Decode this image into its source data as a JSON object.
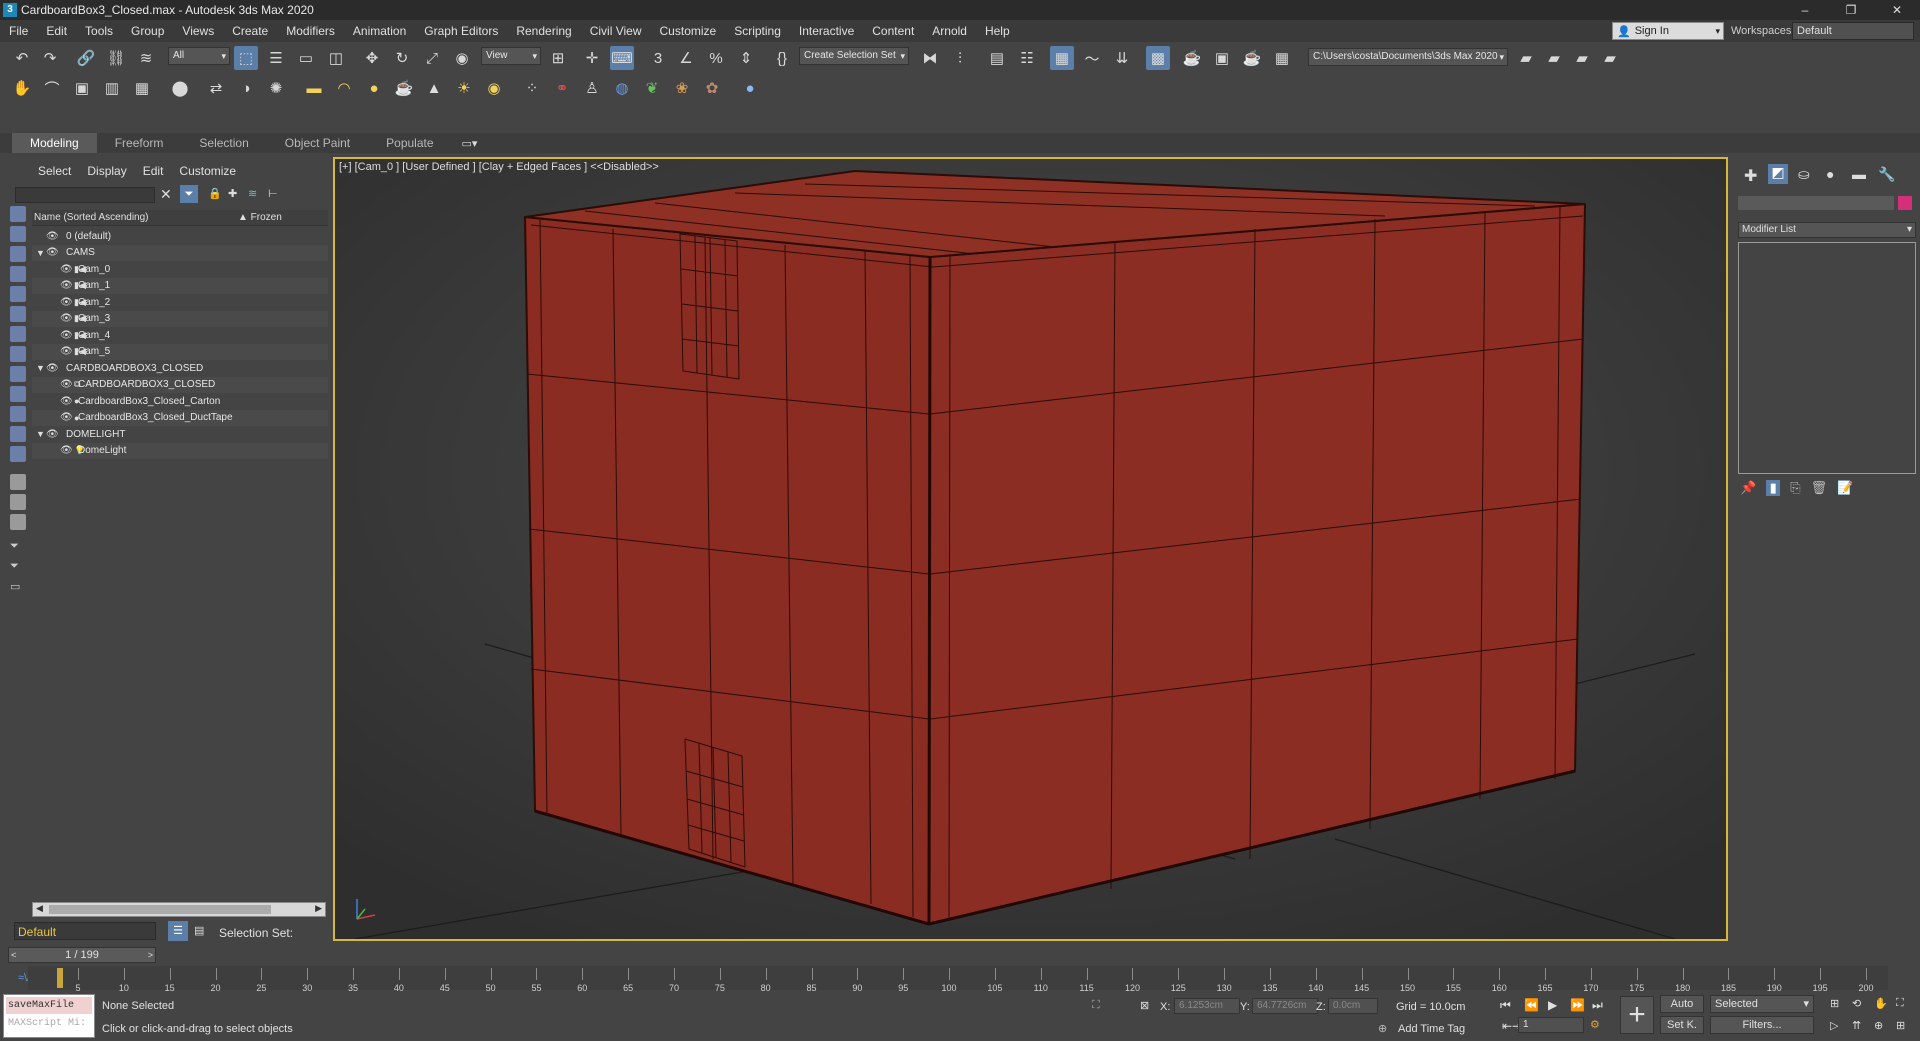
{
  "window": {
    "title": "CardboardBox3_Closed.max - Autodesk 3ds Max 2020",
    "minimize": "–",
    "restore": "❐",
    "close": "✕"
  },
  "menu": [
    "File",
    "Edit",
    "Tools",
    "Group",
    "Views",
    "Create",
    "Modifiers",
    "Animation",
    "Graph Editors",
    "Rendering",
    "Civil View",
    "Customize",
    "Scripting",
    "Interactive",
    "Content",
    "Arnold",
    "Help"
  ],
  "account": {
    "sign_in": "Sign In",
    "workspaces_label": "Workspaces:",
    "workspace": "Default"
  },
  "toolbar": {
    "selection_filter": "All",
    "ref_coord": "View",
    "named_selection": "Create Selection Set",
    "project_path": "C:\\Users\\costa\\Documents\\3ds Max 2020"
  },
  "ribbon": {
    "tabs": [
      "Modeling",
      "Freeform",
      "Selection",
      "Object Paint",
      "Populate"
    ]
  },
  "scene_explorer": {
    "tabs": [
      "Select",
      "Display",
      "Edit",
      "Customize"
    ],
    "column_name": "Name (Sorted Ascending)",
    "column_frozen": "▲ Frozen",
    "rows": [
      {
        "label": "0 (default)",
        "level": 0,
        "icon": "layer-icon"
      },
      {
        "label": "CAMS",
        "level": 0,
        "icon": "layer-icon"
      },
      {
        "label": "Cam_0",
        "level": 1,
        "icon": "camera-icon"
      },
      {
        "label": "Cam_1",
        "level": 1,
        "icon": "camera-icon"
      },
      {
        "label": "Cam_2",
        "level": 1,
        "icon": "camera-icon"
      },
      {
        "label": "Cam_3",
        "level": 1,
        "icon": "camera-icon"
      },
      {
        "label": "Cam_4",
        "level": 1,
        "icon": "camera-icon"
      },
      {
        "label": "Cam_5",
        "level": 1,
        "icon": "camera-icon"
      },
      {
        "label": "CARDBOARDBOX3_CLOSED",
        "level": 0,
        "icon": "layer-icon"
      },
      {
        "label": "CARDBOARDBOX3_CLOSED",
        "level": 1,
        "icon": "group-icon"
      },
      {
        "label": "CardboardBox3_Closed_Carton",
        "level": 1,
        "icon": "sphere-icon"
      },
      {
        "label": "CardboardBox3_Closed_DuctTape",
        "level": 1,
        "icon": "sphere-icon"
      },
      {
        "label": "DOMELIGHT",
        "level": 0,
        "icon": "layer-icon"
      },
      {
        "label": "DomeLight",
        "level": 1,
        "icon": "light-icon"
      }
    ],
    "layer": "Default",
    "selection_set_label": "Selection Set:"
  },
  "viewport": {
    "label": "[+] [Cam_0 ] [User Defined ] [Clay + Edged Faces ]  <<Disabled>>",
    "box_color": "#8b2c22",
    "box_edge_color": "#2a0c08",
    "frame_color": "#d6b83a"
  },
  "command_panel": {
    "modifier_list": "Modifier List",
    "object_color": "#d4307a"
  },
  "timeline": {
    "frame_display": "1 / 199",
    "tick_labels": [
      "5",
      "10",
      "15",
      "20",
      "25",
      "30",
      "35",
      "40",
      "45",
      "50",
      "55",
      "60",
      "65",
      "70",
      "75",
      "80",
      "85",
      "90",
      "95",
      "100",
      "105",
      "110",
      "115",
      "120",
      "125",
      "130",
      "135",
      "140",
      "145",
      "150",
      "155",
      "160",
      "165",
      "170",
      "175",
      "180",
      "185",
      "190",
      "195",
      "200"
    ]
  },
  "status": {
    "maxscript_line": "saveMaxFile",
    "maxscript_hint": "MAXScript Mi:",
    "selection": "None Selected",
    "prompt": "Click or click-and-drag to select objects",
    "x_label": "X:",
    "x_value": "6.1253cm",
    "y_label": "Y:",
    "y_value": "64.7726cm",
    "z_label": "Z:",
    "z_value": "0.0cm",
    "grid": "Grid = 10.0cm",
    "add_time_tag": "Add Time Tag",
    "auto": "Auto",
    "set_key": "Set K.",
    "key_filter": "Selected",
    "filters": "Filters...",
    "frame": "1"
  }
}
